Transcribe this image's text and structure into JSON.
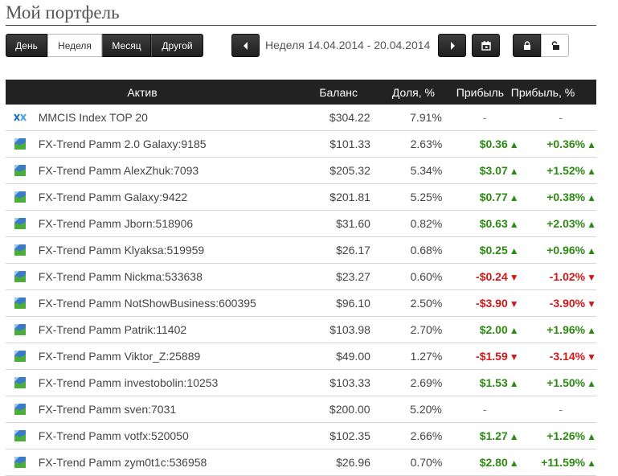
{
  "page": {
    "title": "Мой портфель"
  },
  "period_tabs": [
    "День",
    "Неделя",
    "Месяц",
    "Другой"
  ],
  "active_tab": "Неделя",
  "period": {
    "label": "Неделя 14.04.2014 - 20.04.2014"
  },
  "icons": {
    "prev": "caret-left-icon",
    "next": "caret-right-icon",
    "calendar": "calendar-icon",
    "lock": "lock-icon",
    "unlock": "unlock-icon"
  },
  "colors": {
    "positive": "#2c8a13",
    "negative": "#d01818",
    "header_bg": "#222222"
  },
  "table": {
    "headers": [
      "Актив",
      "Баланс",
      "Доля, %",
      "Прибыль",
      "Прибыль, %"
    ],
    "rows": [
      {
        "icon": "mmcis-index-icon",
        "name": "MMCIS Index TOP 20",
        "balance": "$304.22",
        "share": "7.91%",
        "profit": "-",
        "profit_pct": "-",
        "trend": "none"
      },
      {
        "icon": "fx-trend-icon",
        "name": "FX-Trend Pamm 2.0 Galaxy:9185",
        "balance": "$101.33",
        "share": "2.63%",
        "profit": "$0.36",
        "profit_pct": "+0.36%",
        "trend": "up"
      },
      {
        "icon": "fx-trend-icon",
        "name": "FX-Trend Pamm AlexZhuk:7093",
        "balance": "$205.32",
        "share": "5.34%",
        "profit": "$3.07",
        "profit_pct": "+1.52%",
        "trend": "up"
      },
      {
        "icon": "fx-trend-icon",
        "name": "FX-Trend Pamm Galaxy:9422",
        "balance": "$201.81",
        "share": "5.25%",
        "profit": "$0.77",
        "profit_pct": "+0.38%",
        "trend": "up"
      },
      {
        "icon": "fx-trend-icon",
        "name": "FX-Trend Pamm Jborn:518906",
        "balance": "$31.60",
        "share": "0.82%",
        "profit": "$0.63",
        "profit_pct": "+2.03%",
        "trend": "up"
      },
      {
        "icon": "fx-trend-icon",
        "name": "FX-Trend Pamm Klyaksa:519959",
        "balance": "$26.17",
        "share": "0.68%",
        "profit": "$0.25",
        "profit_pct": "+0.96%",
        "trend": "up"
      },
      {
        "icon": "fx-trend-icon",
        "name": "FX-Trend Pamm Nickma:533638",
        "balance": "$23.27",
        "share": "0.60%",
        "profit": "-$0.24",
        "profit_pct": "-1.02%",
        "trend": "down"
      },
      {
        "icon": "fx-trend-icon",
        "name": "FX-Trend Pamm NotShowBusiness:600395",
        "balance": "$96.10",
        "share": "2.50%",
        "profit": "-$3.90",
        "profit_pct": "-3.90%",
        "trend": "down"
      },
      {
        "icon": "fx-trend-icon",
        "name": "FX-Trend Pamm Patrik:11402",
        "balance": "$103.98",
        "share": "2.70%",
        "profit": "$2.00",
        "profit_pct": "+1.96%",
        "trend": "up"
      },
      {
        "icon": "fx-trend-icon",
        "name": "FX-Trend Pamm Viktor_Z:25889",
        "balance": "$49.00",
        "share": "1.27%",
        "profit": "-$1.59",
        "profit_pct": "-3.14%",
        "trend": "down"
      },
      {
        "icon": "fx-trend-icon",
        "name": "FX-Trend Pamm investobolin:10253",
        "balance": "$103.33",
        "share": "2.69%",
        "profit": "$1.53",
        "profit_pct": "+1.50%",
        "trend": "up"
      },
      {
        "icon": "fx-trend-icon",
        "name": "FX-Trend Pamm sven:7031",
        "balance": "$200.00",
        "share": "5.20%",
        "profit": "-",
        "profit_pct": "-",
        "trend": "none"
      },
      {
        "icon": "fx-trend-icon",
        "name": "FX-Trend Pamm votfx:520050",
        "balance": "$102.35",
        "share": "2.66%",
        "profit": "$1.27",
        "profit_pct": "+1.26%",
        "trend": "up"
      },
      {
        "icon": "fx-trend-icon",
        "name": "FX-Trend Pamm zym0t1c:536958",
        "balance": "$26.96",
        "share": "0.70%",
        "profit": "$2.80",
        "profit_pct": "+11.59%",
        "trend": "up"
      }
    ]
  }
}
